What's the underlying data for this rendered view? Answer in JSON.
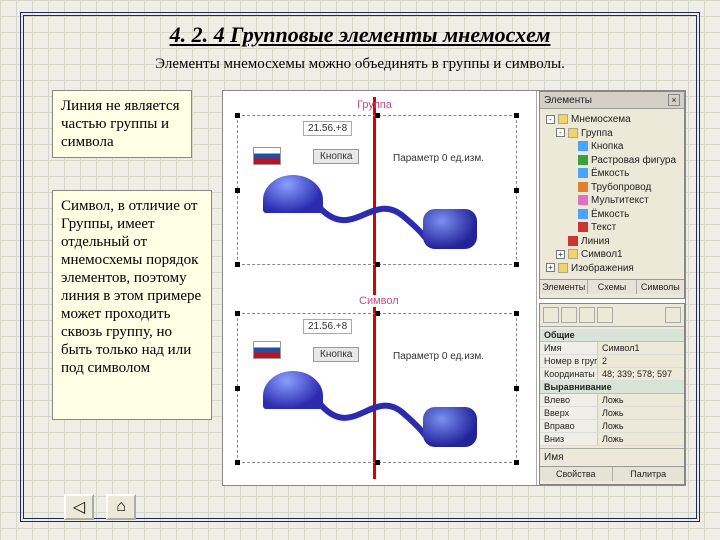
{
  "title": "4. 2. 4 Групповые элементы мнемосхем",
  "subtitle": "Элементы мнемосхемы можно объединять в группы и символы.",
  "notes": {
    "line_not_part": "Линия не является частью группы и символа",
    "symbol_vs_group": "Символ, в отличие от Группы, имеет отдельный от мнемосхемы порядок элементов, поэтому линия в этом примере может проходить сквозь группу, но быть только над или под символом"
  },
  "canvas": {
    "group_label": "Группа",
    "symbol_label": "Символ",
    "value_top": "21.56.+8",
    "value_bottom": "21.56.+8",
    "button_label_top": "Кнопка",
    "button_label_bottom": "Кнопка",
    "param_top": "Параметр 0 ед.изм.",
    "param_bottom": "Параметр 0 ед.изм."
  },
  "elements_panel": {
    "title": "Элементы",
    "tree": [
      {
        "level": 0,
        "icon": "folder",
        "exp": "-",
        "label": "Мнемосхема"
      },
      {
        "level": 1,
        "icon": "folder",
        "exp": "-",
        "label": "Группа"
      },
      {
        "level": 2,
        "icon": "blue",
        "exp": "",
        "label": "Кнопка"
      },
      {
        "level": 2,
        "icon": "green",
        "exp": "",
        "label": "Растровая фигура"
      },
      {
        "level": 2,
        "icon": "blue",
        "exp": "",
        "label": "Ёмкость"
      },
      {
        "level": 2,
        "icon": "orange",
        "exp": "",
        "label": "Трубопровод"
      },
      {
        "level": 2,
        "icon": "pink",
        "exp": "",
        "label": "Мультитекст"
      },
      {
        "level": 2,
        "icon": "blue",
        "exp": "",
        "label": "Ёмкость"
      },
      {
        "level": 2,
        "icon": "red",
        "exp": "",
        "label": "Текст"
      },
      {
        "level": 1,
        "icon": "red",
        "exp": "",
        "label": "Линия"
      },
      {
        "level": 1,
        "icon": "folder",
        "exp": "+",
        "label": "Символ1"
      },
      {
        "level": 0,
        "icon": "folder",
        "exp": "+",
        "label": "Изображения"
      }
    ],
    "tabs": [
      "Элементы",
      "Схемы",
      "Символы"
    ]
  },
  "props_panel": {
    "section_general": "Общие",
    "rows_general": [
      {
        "k": "Имя",
        "v": "Символ1"
      },
      {
        "k": "Номер в группе",
        "v": "2"
      },
      {
        "k": "Координаты",
        "v": "48; 339; 578; 597"
      }
    ],
    "section_layout": "Выравнивание",
    "rows_layout": [
      {
        "k": "Влево",
        "v": "Ложь"
      },
      {
        "k": "Вверх",
        "v": "Ложь"
      },
      {
        "k": "Вправо",
        "v": "Ложь"
      },
      {
        "k": "Вниз",
        "v": "Ложь"
      }
    ],
    "footer_label": "Имя",
    "bottom_tabs": [
      "Свойства",
      "Палитра"
    ]
  },
  "nav": {
    "prev": "◁",
    "home": "⌂"
  }
}
